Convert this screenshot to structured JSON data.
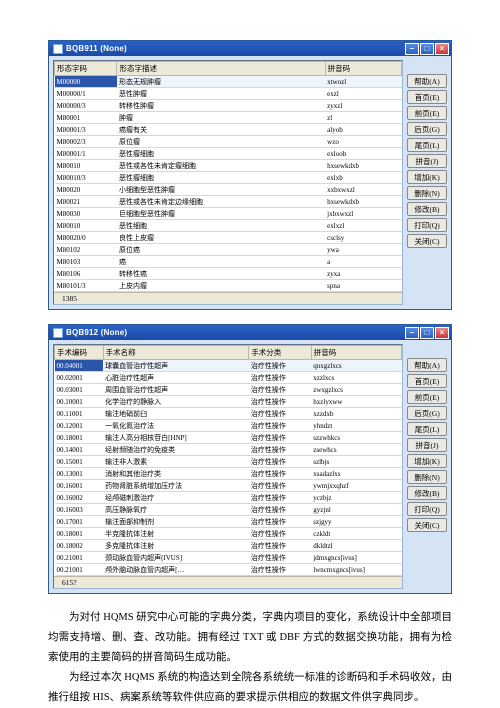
{
  "window1": {
    "title": "BQB911  (None)",
    "columns": [
      "形态字码",
      "形态字描述",
      "拼音码"
    ],
    "col_widths": [
      "18%",
      "60%",
      "22%"
    ],
    "rows": [
      [
        "M00000",
        "形态无规肿瘤",
        "xtwozl"
      ],
      [
        "M00000/1",
        "恶性肿瘤",
        "exzl"
      ],
      [
        "M00000/3",
        "转移性肿瘤",
        "zyxzl"
      ],
      [
        "M80001",
        "肿瘤",
        "zl"
      ],
      [
        "M80001/3",
        "癌瘤有关",
        "alyob"
      ],
      [
        "M80002/3",
        "原位瘤",
        "wzo"
      ],
      [
        "M80001/1",
        "恶性瘤细胞",
        "exloob"
      ],
      [
        "M80010",
        "恶性或各性未肯定瘤细胞",
        "hxsewkdxb"
      ],
      [
        "M80010/3",
        "恶性瘤细胞",
        "exlxb"
      ],
      [
        "M80020",
        "小细胞型恶性肿瘤",
        "xxbxwxzl"
      ],
      [
        "M80021",
        "恶性或各性未肯定边缘细胞",
        "hxsewkdxb"
      ],
      [
        "M80030",
        "巨细胞型恶性肿瘤",
        "jxbxwxzl"
      ],
      [
        "M80010",
        "恶性细胞",
        "exlxzl"
      ],
      [
        "M80020/0",
        "良性上皮瘤",
        "csclsy"
      ],
      [
        "M80102",
        "原位癌",
        "ywa"
      ],
      [
        "M80103",
        "癌",
        "a"
      ],
      [
        "M80106",
        "转移性癌",
        "zyxa"
      ],
      [
        "M80101/3",
        "上皮内瘤",
        "spna"
      ]
    ],
    "footer": "1385",
    "buttons": [
      "帮助(A)",
      "首页(E)",
      "前页(E)",
      "后页(G)",
      "尾页(L)",
      "拼音(J)",
      "增加(K)",
      "删除(N)",
      "修改(B)",
      "打印(Q)",
      "关闭(C)"
    ]
  },
  "window2": {
    "title": "BQB912  (None)",
    "columns": [
      "手术编码",
      "手术名称",
      "手术分类",
      "拼音码"
    ],
    "col_widths": [
      "14%",
      "42%",
      "18%",
      "26%"
    ],
    "rows": [
      [
        "00.04001",
        "球囊血管治疗性超声",
        "治疗性操作",
        "qnxgzlxcs"
      ],
      [
        "00.02001",
        "心脏治疗性超声",
        "治疗性操作",
        "xzzlxcs"
      ],
      [
        "00.03001",
        "周围血管治疗性超声",
        "治疗性操作",
        "zwxgzlxcs"
      ],
      [
        "00.10001",
        "化学治疗的静脉入",
        "治疗性操作",
        "hxzlyxww"
      ],
      [
        "00.11001",
        "输注地硝前臼",
        "治疗性操作",
        "xzzdxb"
      ],
      [
        "00.12001",
        "一氧化氮治疗法",
        "治疗性操作",
        "yhndzt"
      ],
      [
        "00.18001",
        "输注人高分相核苷白[HNP]",
        "治疗性操作",
        "szzwhkcs"
      ],
      [
        "00.14001",
        "经射频随治疗的免疫类",
        "治疗性操作",
        "zsewhcs"
      ],
      [
        "00.15001",
        "输注非人激素",
        "治疗性操作",
        "szlbjs"
      ],
      [
        "00.13001",
        "消射和其他治疗类",
        "治疗性操作",
        "xsadazlxs"
      ],
      [
        "00.16001",
        "药物肾脏系统增加压疗法",
        "治疗性操作",
        "ywmjxxqhzf"
      ],
      [
        "00.16002",
        "经颅磁刺激治疗",
        "治疗性操作",
        "yczbjz"
      ],
      [
        "00.16003",
        "高压静脉氧疗",
        "治疗性操作",
        "gyzjnl"
      ],
      [
        "00.17001",
        "输注面部抑制剂",
        "治疗性操作",
        "szjgyy"
      ],
      [
        "00.18001",
        "半克隆抗体注射",
        "治疗性操作",
        "czkldt"
      ],
      [
        "00.18002",
        "多克隆抗体注射",
        "治疗性操作",
        "dkldtzl"
      ],
      [
        "00.21001",
        "颈动脉血管内超声[IVUS]",
        "治疗性操作",
        "jdmxgncs[ivus]"
      ],
      [
        "00.21001",
        "颅外脑动脉血管内超声[…",
        "治疗性操作",
        "lwncmxgncs[ivus]"
      ]
    ],
    "footer": "615?",
    "buttons": [
      "帮助(A)",
      "首页(E)",
      "前页(E)",
      "后页(G)",
      "尾页(L)",
      "拼音(J)",
      "增加(K)",
      "删除(N)",
      "修改(B)",
      "打印(Q)",
      "关闭(C)"
    ]
  },
  "paragraphs": [
    "为对付 HQMS 研究中心可能的字典分类，字典内项目的变化，系统设计中全部项目均需支持增、删、查、改功能。拥有经过 TXT 或 DBF 方式的数据交换功能，拥有为检索使用的主要简码的拼音简码生成功能。",
    "为经过本次 HQMS 系统的构造达到全院各系统统一标准的诊断码和手术码收效，由推行组按 HIS、病案系统等软件供应商的要求提示供相应的数据文件供字典同步。"
  ]
}
